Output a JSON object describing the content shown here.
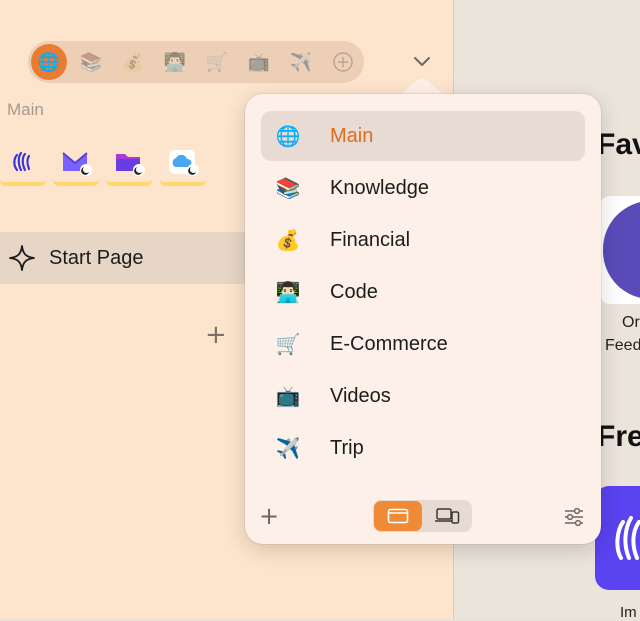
{
  "space_bar": {
    "icons": [
      "🌐",
      "📚",
      "💰",
      "👨🏻‍💻",
      "🛒",
      "📺",
      "✈️"
    ],
    "active_index": 0,
    "add_label": "+"
  },
  "sidebar": {
    "section_label": "Main",
    "pinned_icons": [
      "hand-wave-app-icon",
      "proton-mail-icon",
      "proton-drive-icon",
      "cloud-app-icon"
    ],
    "start_page_label": "Start Page",
    "add_label": "+"
  },
  "menu": {
    "items": [
      {
        "icon": "🌐",
        "label": "Main",
        "selected": true
      },
      {
        "icon": "📚",
        "label": "Knowledge"
      },
      {
        "icon": "💰",
        "label": "Financial"
      },
      {
        "icon": "👨🏻‍💻",
        "label": "Code"
      },
      {
        "icon": "🛒",
        "label": "E-Commerce"
      },
      {
        "icon": "📺",
        "label": "Videos"
      },
      {
        "icon": "✈️",
        "label": "Trip"
      }
    ],
    "add_label": "+",
    "accent": "#e97b32"
  },
  "content": {
    "favorites_title": "Fav",
    "frequent_title": "Fre",
    "card1_line1": "Or",
    "card1_line2": "Feed",
    "card2_label": "Im"
  }
}
